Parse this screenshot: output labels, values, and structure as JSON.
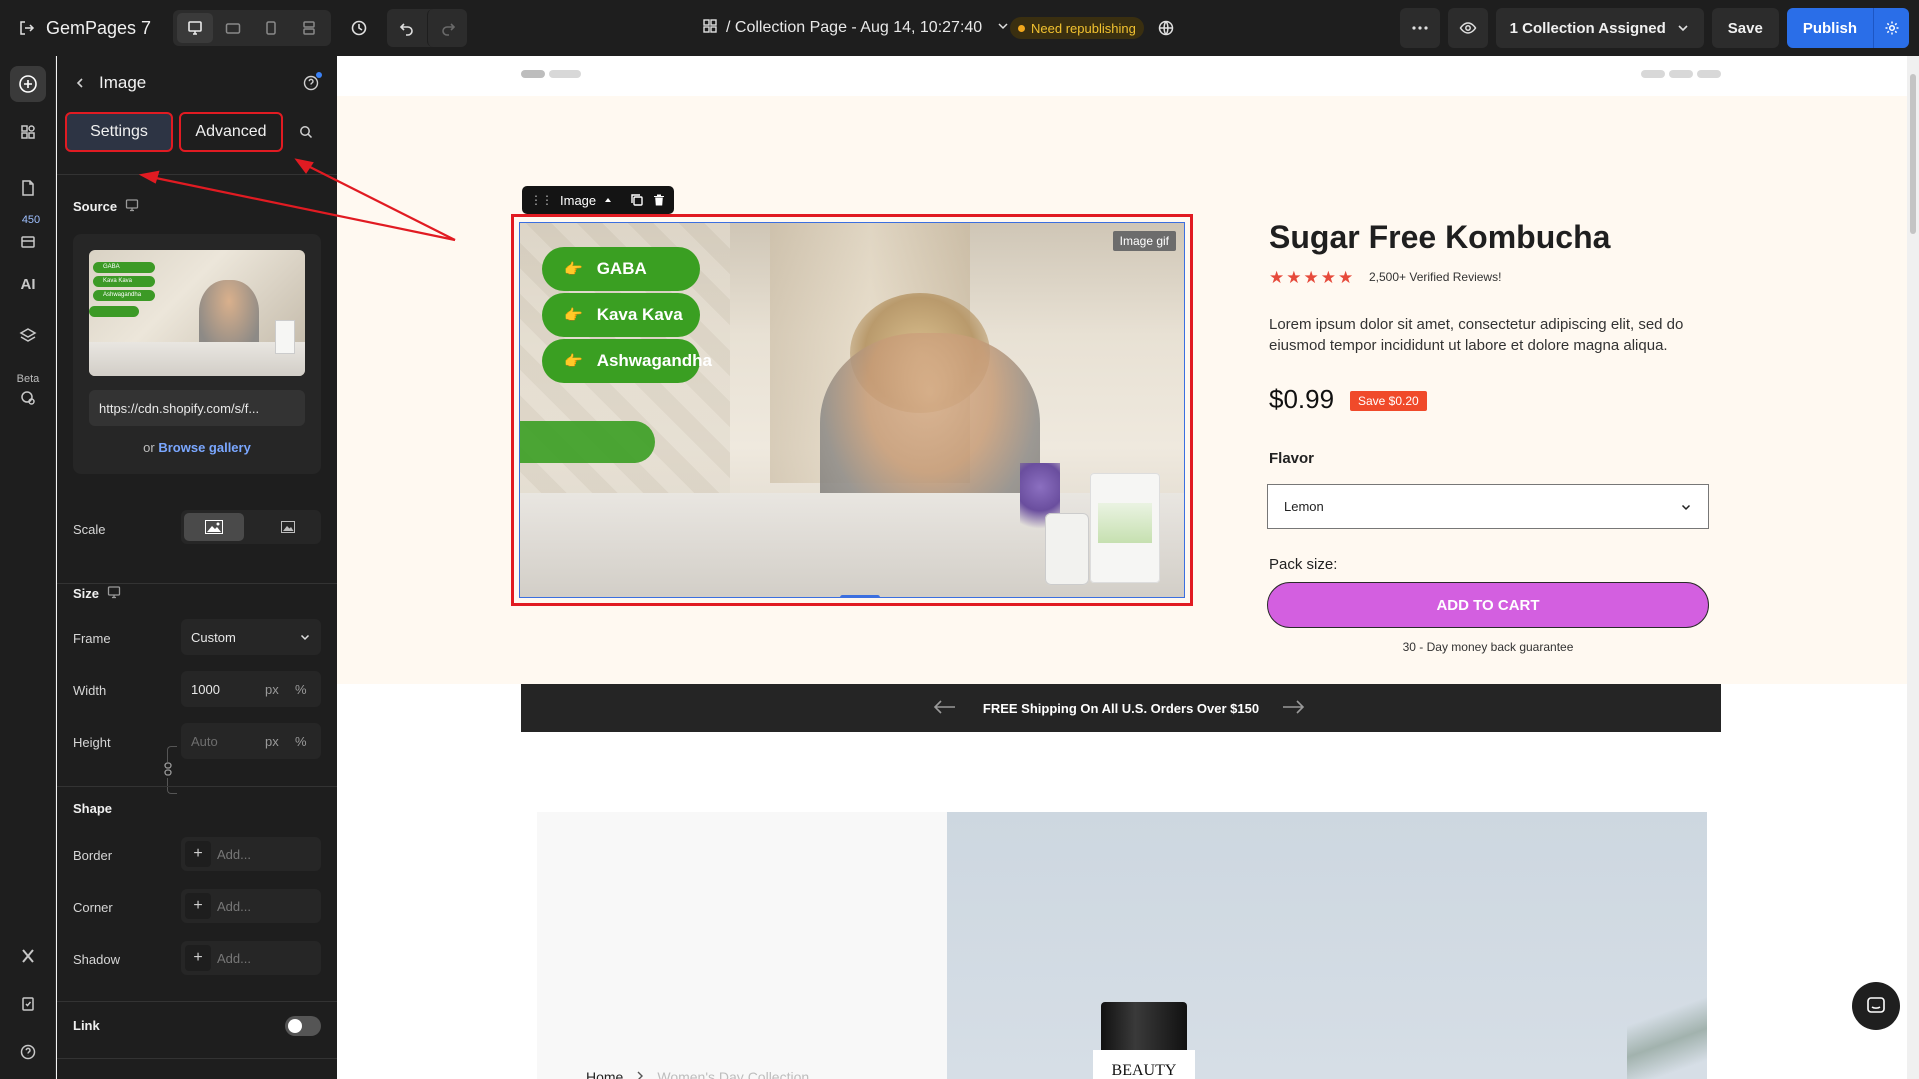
{
  "topbar": {
    "app_name": "GemPages 7",
    "page_title": "/ Collection Page - Aug 14, 10:27:40",
    "status_badge": "Need republishing",
    "assign_label": "1 Collection Assigned",
    "save_label": "Save",
    "publish_label": "Publish"
  },
  "rail": {
    "badge_count": "450",
    "ai_label": "AI",
    "beta_label": "Beta"
  },
  "panel": {
    "title": "Image",
    "tabs": {
      "settings": "Settings",
      "advanced": "Advanced"
    },
    "source": {
      "title": "Source",
      "url": "https://cdn.shopify.com/s/f...",
      "or_text": "or",
      "browse_label": "Browse gallery"
    },
    "scale_label": "Scale",
    "size": {
      "title": "Size",
      "frame_label": "Frame",
      "frame_value": "Custom",
      "width_label": "Width",
      "width_value": "1000",
      "height_label": "Height",
      "height_placeholder": "Auto",
      "unit_px": "px",
      "unit_pct": "%"
    },
    "shape": {
      "title": "Shape",
      "border_label": "Border",
      "corner_label": "Corner",
      "shadow_label": "Shadow",
      "add_placeholder": "Add..."
    },
    "link": {
      "title": "Link",
      "enabled": false
    }
  },
  "canvas": {
    "image_toolbar_label": "Image",
    "image_tag": "Image gif",
    "pills": [
      "GABA",
      "Kava Kava",
      "Ashwagandha"
    ],
    "product": {
      "title": "Sugar Free Kombucha",
      "rating_stars": 5,
      "reviews": "2,500+ Verified Reviews!",
      "description": "Lorem ipsum dolor sit amet, consectetur adipiscing elit, sed do eiusmod tempor incididunt ut labore et dolore magna aliqua.",
      "price": "$0.99",
      "save_badge": "Save $0.20",
      "flavor_label": "Flavor",
      "flavor_value": "Lemon",
      "pack_label": "Pack size:",
      "add_to_cart": "ADD TO CART",
      "guarantee": "30 - Day money back guarantee"
    },
    "shipping_text": "FREE Shipping On All U.S. Orders Over $150",
    "banner": {
      "jar_text": "BEAUTY",
      "breadcrumb": [
        "Home",
        "Women's Day Collection"
      ]
    }
  },
  "colors": {
    "publish": "#2a6ee8",
    "annotation": "#e11b22",
    "add_to_cart": "#d35fe0",
    "pill_green": "#3a9f22",
    "star": "#e64a3b",
    "save_badge": "#f04a2a"
  }
}
